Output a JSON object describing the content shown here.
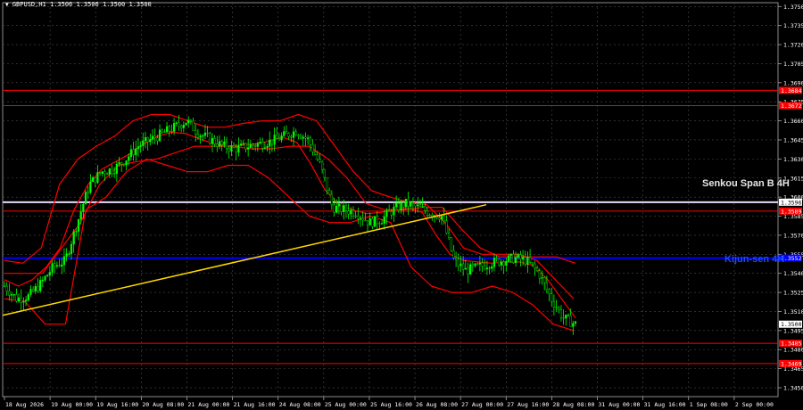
{
  "header": {
    "symbol_line": "GBPUSD,H1  1.3506 1.3506 1.3500 1.3500",
    "window_icon": "down-triangle-icon"
  },
  "labels": {
    "senkou_span_b": "Senkou Span B 4H",
    "kijun_sen": "Kijun-sen 4H"
  },
  "colors": {
    "background": "#000000",
    "grid": "#4a4a4a",
    "bull_candle": "#00ff00",
    "ichimoku": "#ff0000",
    "trendline": "#ffd700",
    "kijun_line": "#0000ff",
    "senkou_line": "#ffffff",
    "kijun_text": "#1e4bff",
    "senkou_text": "#e6e6e6",
    "price_tag": "#ff0000"
  },
  "chart_data": {
    "type": "candlestick",
    "symbol": "GBPUSD",
    "timeframe": "H1",
    "ohlc_last": {
      "open": 1.3506,
      "high": 1.3506,
      "low": 1.35,
      "close": 1.35
    },
    "y_ticks": [
      "1.3750",
      "1.3735",
      "1.3720",
      "1.3705",
      "1.3690",
      "1.3675",
      "1.3660",
      "1.3645",
      "1.3630",
      "1.3615",
      "1.3600",
      "1.3585",
      "1.3570",
      "1.3555",
      "1.3540",
      "1.3525",
      "1.3510",
      "1.3495",
      "1.3480",
      "1.3465",
      "1.3450"
    ],
    "ylim": [
      1.3443,
      1.3753
    ],
    "x_labels": [
      "18 Aug 2026",
      "19 Aug 00:00",
      "19 Aug 16:00",
      "20 Aug 08:00",
      "21 Aug 00:00",
      "21 Aug 16:00",
      "24 Aug 08:00",
      "25 Aug 00:00",
      "25 Aug 16:00",
      "26 Aug 08:00",
      "27 Aug 00:00",
      "27 Aug 16:00",
      "28 Aug 08:00",
      "31 Aug 00:00",
      "31 Aug 16:00",
      "1 Sep 08:00",
      "2 Sep 00:00"
    ],
    "horizontal_levels": [
      {
        "name": "Red level",
        "value": 1.3684,
        "tag": "1.3684"
      },
      {
        "name": "Red level",
        "value": 1.3672,
        "tag": "1.3672"
      },
      {
        "name": "Senkou Span B 4H",
        "value": 1.3596,
        "tag": "1.3596"
      },
      {
        "name": "Red level",
        "value": 1.3589,
        "tag": "1.3589"
      },
      {
        "name": "Kijun-sen 4H",
        "value": 1.3552,
        "tag": "1.3552"
      },
      {
        "name": "Red level",
        "value": 1.3485,
        "tag": "1.3485"
      },
      {
        "name": "Red level",
        "value": 1.3469,
        "tag": "1.3469"
      }
    ],
    "current_price": {
      "value": 1.35,
      "tag": "1.3500"
    },
    "trendline": {
      "start": 1.3507,
      "end": 1.3594
    },
    "price_path": [
      1.353,
      1.352,
      1.3522,
      1.3532,
      1.3545,
      1.355,
      1.358,
      1.361,
      1.362,
      1.3622,
      1.363,
      1.364,
      1.3645,
      1.365,
      1.3655,
      1.366,
      1.365,
      1.3645,
      1.364,
      1.3638,
      1.364,
      1.3642,
      1.3644,
      1.3648,
      1.3652,
      1.3645,
      1.3625,
      1.3592,
      1.359,
      1.3588,
      1.358,
      1.3582,
      1.359,
      1.3595,
      1.3592,
      1.3588,
      1.3585,
      1.355,
      1.3542,
      1.3545,
      1.3548,
      1.355,
      1.3552,
      1.355,
      1.354,
      1.352,
      1.3505,
      1.35
    ],
    "tenkan_sen": [
      1.3535,
      1.353,
      1.3535,
      1.3545,
      1.356,
      1.359,
      1.361,
      1.3622,
      1.3628,
      1.3634,
      1.3642,
      1.3648,
      1.3651,
      1.365,
      1.3646,
      1.3642,
      1.364,
      1.3641,
      1.3642,
      1.3644,
      1.3647,
      1.3643,
      1.3626,
      1.3606,
      1.3594,
      1.359,
      1.3587,
      1.3588,
      1.359,
      1.3591,
      1.3588,
      1.357,
      1.3555,
      1.355,
      1.3549,
      1.3548,
      1.3549,
      1.3549,
      1.3546,
      1.3535,
      1.352,
      1.3505
    ],
    "kijun_sen": [
      1.354,
      1.354,
      1.354,
      1.356,
      1.358,
      1.361,
      1.3625,
      1.3628,
      1.363,
      1.3635,
      1.364,
      1.364,
      1.364,
      1.3638,
      1.3638,
      1.364,
      1.364,
      1.363,
      1.3615,
      1.3595,
      1.359,
      1.359,
      1.3592,
      1.3592,
      1.3575,
      1.356,
      1.3553,
      1.3553,
      1.3553,
      1.3553,
      1.3548
    ],
    "upper_channel": [
      1.355,
      1.3548,
      1.356,
      1.361,
      1.363,
      1.364,
      1.3648,
      1.366,
      1.3665,
      1.3665,
      1.366,
      1.3655,
      1.3655,
      1.3658,
      1.366,
      1.366,
      1.3665,
      1.366,
      1.364,
      1.362,
      1.3605,
      1.36,
      1.3596,
      1.3594,
      1.358,
      1.356,
      1.3555,
      1.3555,
      1.3555,
      1.355,
      1.3535,
      1.352
    ],
    "lower_channel": [
      1.352,
      1.3518,
      1.35,
      1.35,
      1.359,
      1.36,
      1.362,
      1.363,
      1.3625,
      1.362,
      1.362,
      1.3625,
      1.3625,
      1.3615,
      1.36,
      1.3585,
      1.358,
      1.358,
      1.3585,
      1.358,
      1.3545,
      1.353,
      1.3525,
      1.3525,
      1.353,
      1.3525,
      1.3515,
      1.35,
      1.3495
    ]
  }
}
